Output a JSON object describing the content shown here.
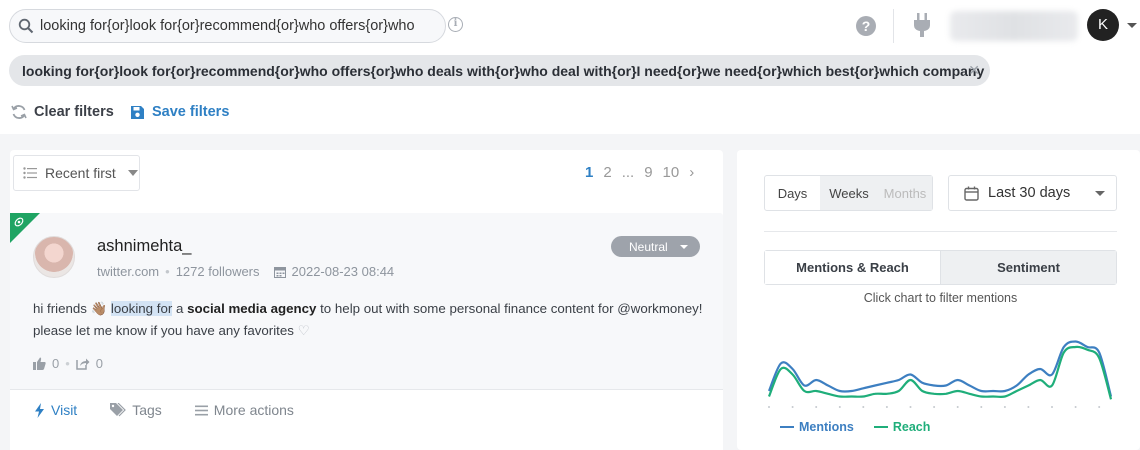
{
  "search": {
    "value": "looking for{or}look for{or}recommend{or}who offers{or}who"
  },
  "header": {
    "avatar_initial": "K"
  },
  "filter_chip": {
    "text": "looking for{or}look for{or}recommend{or}who offers{or}who deals with{or}who deal with{or}I need{or}we need{or}which best{or}which company"
  },
  "filter_actions": {
    "clear_label": "Clear filters",
    "save_label": "Save filters"
  },
  "sort": {
    "selected": "Recent first"
  },
  "pagination": {
    "pages": [
      "1",
      "2",
      "...",
      "9",
      "10"
    ],
    "current": "1",
    "next": "›"
  },
  "mention": {
    "author": "ashnimehta_",
    "source": "twitter.com",
    "followers": "1272 followers",
    "date": "2022-08-23 08:44",
    "sentiment": "Neutral",
    "text_pre": "hi friends ",
    "emoji": "👋🏽",
    "highlight": "looking for",
    "text_mid": " a ",
    "bold": "social media agency",
    "text_post": " to help out with some personal finance content for @workmoney!",
    "text_line2": "please let me know if you have any favorites",
    "heart": "♡",
    "likes": "0",
    "shares": "0",
    "actions": {
      "visit": "Visit",
      "tags": "Tags",
      "more": "More actions"
    }
  },
  "analytics": {
    "period": {
      "days": "Days",
      "weeks": "Weeks",
      "months": "Months"
    },
    "range": "Last 30 days",
    "tabs": {
      "mentions_reach": "Mentions & Reach",
      "sentiment": "Sentiment"
    },
    "hint": "Click chart to filter mentions",
    "legend": {
      "mentions": "Mentions",
      "reach": "Reach"
    },
    "colors": {
      "mentions": "#3d7fc1",
      "reach": "#1fae7a"
    }
  },
  "chart_data": {
    "type": "line",
    "title": "",
    "xlabel": "",
    "ylabel": "",
    "x": [
      1,
      2,
      3,
      4,
      5,
      6,
      7,
      8,
      9,
      10,
      11,
      12,
      13,
      14,
      15,
      16,
      17,
      18,
      19,
      20,
      21,
      22,
      23,
      24,
      25,
      26,
      27,
      28,
      29,
      30
    ],
    "series": [
      {
        "name": "Mentions",
        "values": [
          2,
          7,
          6,
          3,
          4,
          3,
          2,
          2,
          2.5,
          3,
          3.5,
          4,
          5,
          3.5,
          3,
          3,
          4,
          3,
          2,
          2,
          2,
          3,
          5,
          6,
          5,
          10,
          11,
          10,
          9,
          1
        ]
      },
      {
        "name": "Reach",
        "values": [
          1,
          6,
          5,
          2,
          2,
          1.5,
          1,
          1,
          1,
          1.5,
          1.5,
          2,
          4,
          2,
          1.5,
          1.5,
          2,
          1.5,
          1,
          1,
          1,
          2,
          3,
          4,
          3,
          9,
          10,
          9.5,
          8,
          0.5
        ]
      }
    ],
    "ylim": [
      0,
      12
    ],
    "grid": false,
    "legend_position": "bottom"
  }
}
